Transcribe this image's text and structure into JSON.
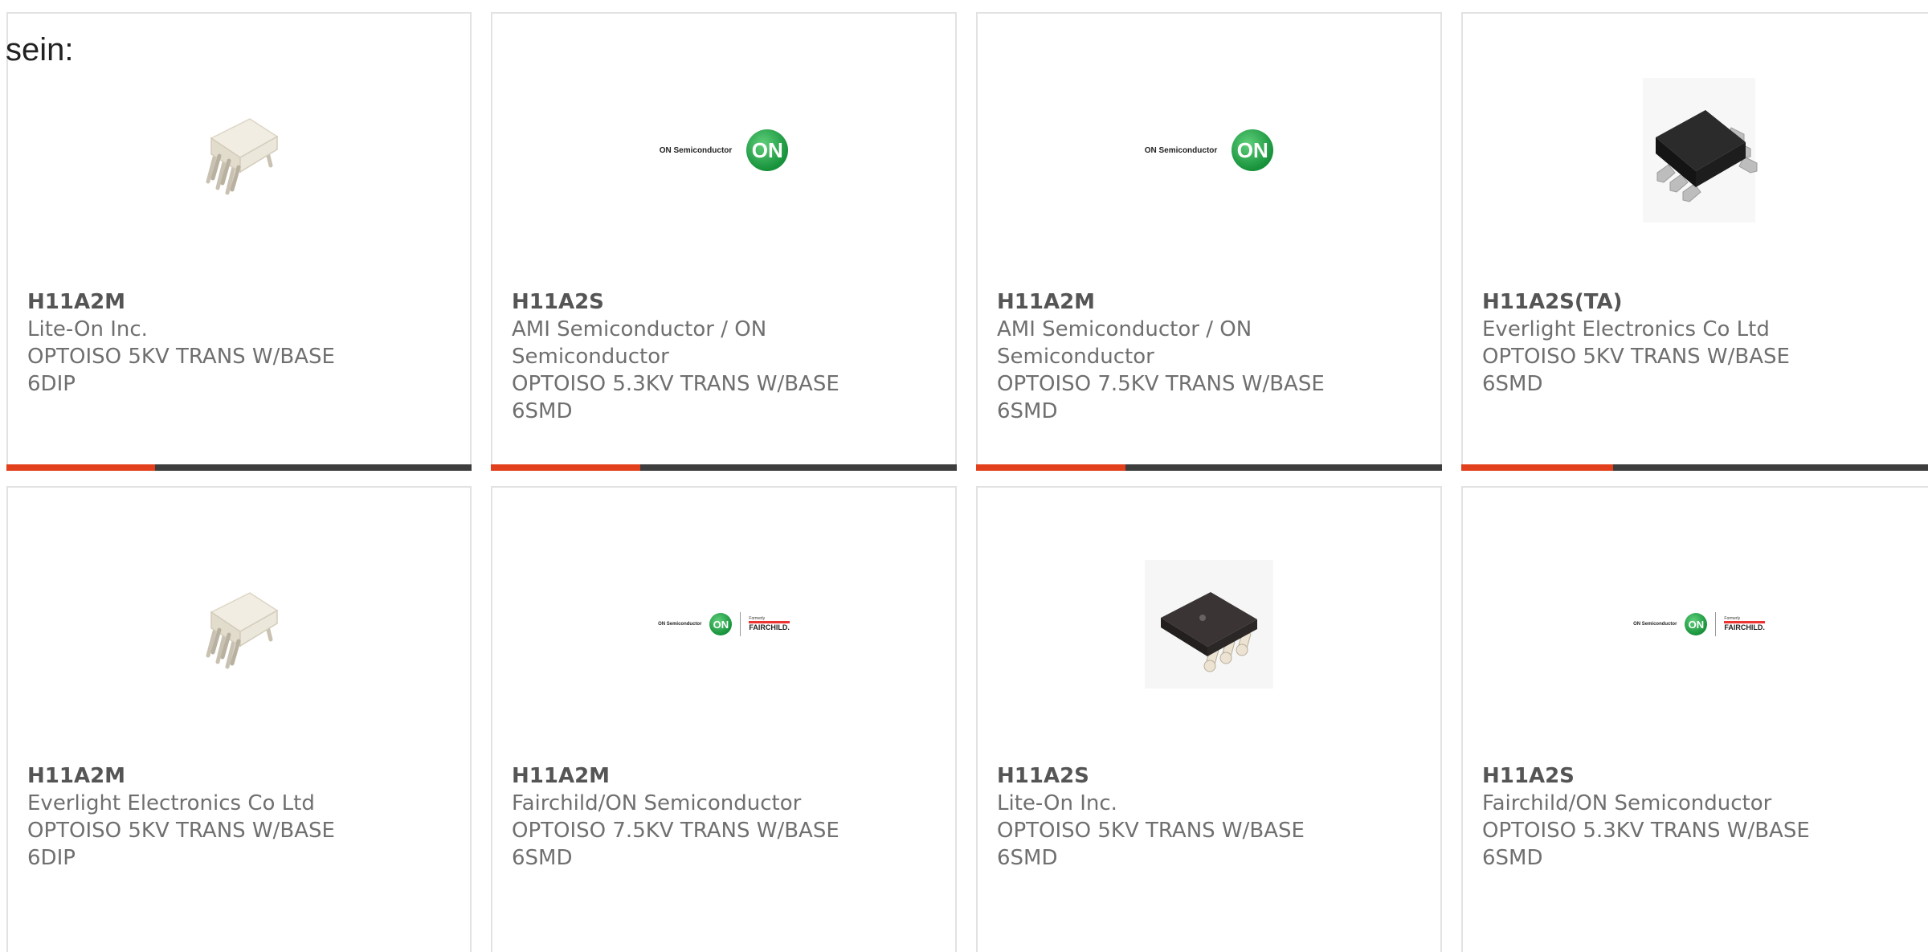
{
  "heading": "sein:",
  "colors": {
    "accent": "#e2401c",
    "bar": "#3d3d3d",
    "text": "#6f6f6f"
  },
  "cards": [
    {
      "part": "H11A2M",
      "manufacturer": "Lite-On Inc.",
      "description": "OPTOISO 5KV TRANS W/BASE 6DIP",
      "image": "dip6-white-package",
      "progress": 0.32
    },
    {
      "part": "H11A2S",
      "manufacturer": "AMI Semiconductor / ON Semiconductor",
      "description": "OPTOISO 5.3KV TRANS W/BASE 6SMD",
      "image": "on-semiconductor-logo",
      "logo_text": "ON Semiconductor",
      "logo_badge": "ON",
      "progress": 0.32
    },
    {
      "part": "H11A2M",
      "manufacturer": "AMI Semiconductor / ON Semiconductor",
      "description": "OPTOISO 7.5KV TRANS W/BASE 6SMD",
      "image": "on-semiconductor-logo",
      "logo_text": "ON Semiconductor",
      "logo_badge": "ON",
      "progress": 0.32
    },
    {
      "part": "H11A2S(TA)",
      "manufacturer": "Everlight Electronics Co Ltd",
      "description": "OPTOISO 5KV TRANS W/BASE 6SMD",
      "image": "smd6-black-package",
      "progress": 0.32
    },
    {
      "part": "H11A2M",
      "manufacturer": "Everlight Electronics Co Ltd",
      "description": "OPTOISO 5KV TRANS W/BASE 6DIP",
      "image": "dip6-white-package"
    },
    {
      "part": "H11A2M",
      "manufacturer": "Fairchild/ON Semiconductor",
      "description": "OPTOISO 7.5KV TRANS W/BASE 6SMD",
      "image": "on-fairchild-logo",
      "logo_text": "ON Semiconductor",
      "logo_badge": "ON",
      "logo_formerly": "Formerly",
      "logo_fairchild": "FAIRCHILD."
    },
    {
      "part": "H11A2S",
      "manufacturer": "Lite-On Inc.",
      "description": "OPTOISO 5KV TRANS W/BASE 6SMD",
      "image": "smd6-dark-package"
    },
    {
      "part": "H11A2S",
      "manufacturer": "Fairchild/ON Semiconductor",
      "description": "OPTOISO 5.3KV TRANS W/BASE 6SMD",
      "image": "on-fairchild-logo",
      "logo_text": "ON Semiconductor",
      "logo_badge": "ON",
      "logo_formerly": "Formerly",
      "logo_fairchild": "FAIRCHILD."
    }
  ]
}
